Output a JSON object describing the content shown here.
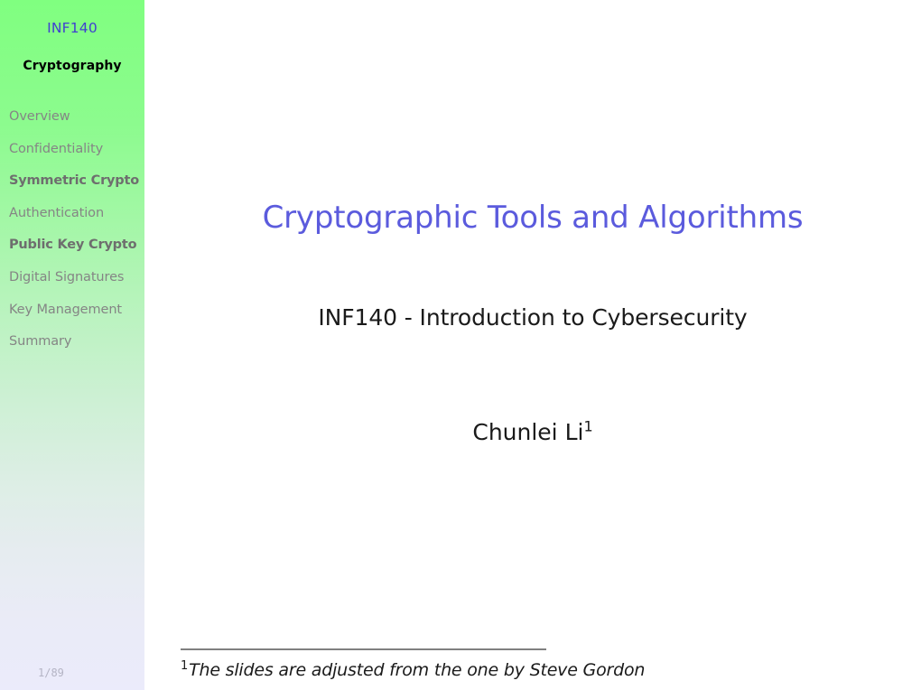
{
  "sidebar": {
    "course_code": "INF140",
    "current_section": "Cryptography",
    "items": [
      {
        "label": "Overview",
        "emphasis": "normal"
      },
      {
        "label": "Confidentiality",
        "emphasis": "normal"
      },
      {
        "label": "Symmetric Crypto",
        "emphasis": "bold"
      },
      {
        "label": "Authentication",
        "emphasis": "normal"
      },
      {
        "label": "Public Key Crypto",
        "emphasis": "bold"
      },
      {
        "label": "Digital Signatures",
        "emphasis": "normal"
      },
      {
        "label": "Key Management",
        "emphasis": "normal"
      },
      {
        "label": "Summary",
        "emphasis": "normal"
      }
    ],
    "page_number": "1/89"
  },
  "main": {
    "title": "Cryptographic Tools and Algorithms",
    "subtitle": "INF140 - Introduction to Cybersecurity",
    "author_name": "Chunlei Li",
    "author_footnote_mark": "1"
  },
  "footnote": {
    "mark": "1",
    "text": "The slides are adjusted from the one by Steve Gordon"
  },
  "colors": {
    "accent_blue": "#5b5bdd",
    "sidebar_title_blue": "#4040d0",
    "sidebar_top_green": "#80ff80",
    "sidebar_bottom": "#ebebfb",
    "nav_inactive_gray": "#858585",
    "nav_bold_gray": "#6e6e6e",
    "page_number_gray": "#b4b4c4",
    "body_text": "#1a1a1a",
    "background": "#ffffff"
  }
}
